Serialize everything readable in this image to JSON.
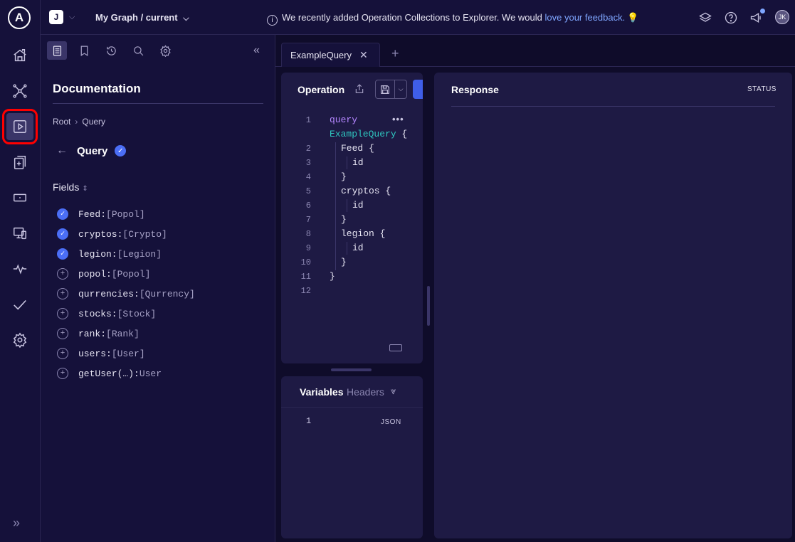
{
  "rail": {
    "logo": "A",
    "items": [
      {
        "name": "home-icon"
      },
      {
        "name": "graph-icon"
      },
      {
        "name": "explorer-icon",
        "active": true
      },
      {
        "name": "changelog-icon"
      },
      {
        "name": "fields-icon"
      },
      {
        "name": "clients-icon"
      },
      {
        "name": "operations-icon"
      },
      {
        "name": "checks-icon"
      },
      {
        "name": "settings-icon"
      }
    ],
    "expand_glyph": "»"
  },
  "topbar": {
    "org_initial": "J",
    "graph_name": "My Graph / current",
    "banner_text": "We recently added Operation Collections to Explorer. We would ",
    "banner_link": "love your feedback.",
    "banner_emoji": "💡",
    "user_initials": "JK"
  },
  "docs": {
    "title": "Documentation",
    "breadcrumb_root": "Root",
    "breadcrumb_sep": "›",
    "breadcrumb_current": "Query",
    "type_name": "Query",
    "fields_label": "Fields",
    "fields": [
      {
        "name": "Feed:",
        "type": "[Popol]",
        "selected": true
      },
      {
        "name": "cryptos:",
        "type": "[Crypto]",
        "selected": true
      },
      {
        "name": "legion:",
        "type": "[Legion]",
        "selected": true
      },
      {
        "name": "popol:",
        "type": "[Popol]",
        "selected": false
      },
      {
        "name": "qurrencies:",
        "type": "[Qurrency]",
        "selected": false
      },
      {
        "name": "stocks:",
        "type": "[Stock]",
        "selected": false
      },
      {
        "name": "rank:",
        "type": "[Rank]",
        "selected": false
      },
      {
        "name": "users:",
        "type": "[User]",
        "selected": false
      },
      {
        "name": "getUser(…):",
        "type": "User",
        "selected": false
      }
    ]
  },
  "tabs": {
    "active_tab": "ExampleQuery",
    "close_glyph": "✕",
    "add_glyph": "+"
  },
  "operation": {
    "title": "Operation",
    "lines": [
      {
        "n": "1",
        "text": ""
      },
      {
        "n": "",
        "text": ""
      },
      {
        "n": "2",
        "text": "Feed {"
      },
      {
        "n": "3",
        "text": "id"
      },
      {
        "n": "4",
        "text": "}"
      },
      {
        "n": "5",
        "text": "cryptos {"
      },
      {
        "n": "6",
        "text": "id"
      },
      {
        "n": "7",
        "text": "}"
      },
      {
        "n": "8",
        "text": "legion {"
      },
      {
        "n": "9",
        "text": "id"
      },
      {
        "n": "10",
        "text": "}"
      },
      {
        "n": "11",
        "text": "}"
      },
      {
        "n": "12",
        "text": ""
      }
    ],
    "keyword": "query",
    "op_name": "ExampleQuery",
    "op_brace": " {",
    "more_glyph": "•••"
  },
  "variables": {
    "title": "Variables",
    "headers_label": "Headers",
    "line_number": "1",
    "format": "JSON"
  },
  "response": {
    "title": "Response",
    "status_label": "STATUS"
  }
}
